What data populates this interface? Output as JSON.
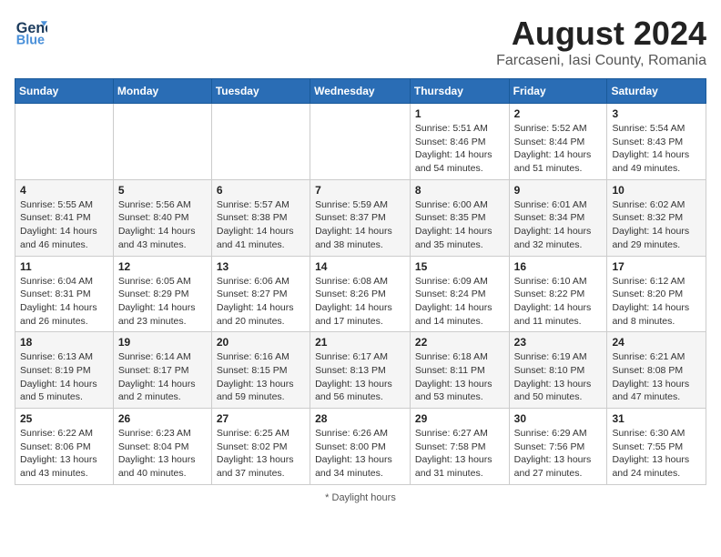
{
  "header": {
    "logo_line1": "General",
    "logo_line2": "Blue",
    "main_title": "August 2024",
    "subtitle": "Farcaseni, Iasi County, Romania"
  },
  "weekdays": [
    "Sunday",
    "Monday",
    "Tuesday",
    "Wednesday",
    "Thursday",
    "Friday",
    "Saturday"
  ],
  "weeks": [
    [
      {
        "day": "",
        "sunrise": "",
        "sunset": "",
        "daylight": ""
      },
      {
        "day": "",
        "sunrise": "",
        "sunset": "",
        "daylight": ""
      },
      {
        "day": "",
        "sunrise": "",
        "sunset": "",
        "daylight": ""
      },
      {
        "day": "",
        "sunrise": "",
        "sunset": "",
        "daylight": ""
      },
      {
        "day": "1",
        "sunrise": "Sunrise: 5:51 AM",
        "sunset": "Sunset: 8:46 PM",
        "daylight": "Daylight: 14 hours and 54 minutes."
      },
      {
        "day": "2",
        "sunrise": "Sunrise: 5:52 AM",
        "sunset": "Sunset: 8:44 PM",
        "daylight": "Daylight: 14 hours and 51 minutes."
      },
      {
        "day": "3",
        "sunrise": "Sunrise: 5:54 AM",
        "sunset": "Sunset: 8:43 PM",
        "daylight": "Daylight: 14 hours and 49 minutes."
      }
    ],
    [
      {
        "day": "4",
        "sunrise": "Sunrise: 5:55 AM",
        "sunset": "Sunset: 8:41 PM",
        "daylight": "Daylight: 14 hours and 46 minutes."
      },
      {
        "day": "5",
        "sunrise": "Sunrise: 5:56 AM",
        "sunset": "Sunset: 8:40 PM",
        "daylight": "Daylight: 14 hours and 43 minutes."
      },
      {
        "day": "6",
        "sunrise": "Sunrise: 5:57 AM",
        "sunset": "Sunset: 8:38 PM",
        "daylight": "Daylight: 14 hours and 41 minutes."
      },
      {
        "day": "7",
        "sunrise": "Sunrise: 5:59 AM",
        "sunset": "Sunset: 8:37 PM",
        "daylight": "Daylight: 14 hours and 38 minutes."
      },
      {
        "day": "8",
        "sunrise": "Sunrise: 6:00 AM",
        "sunset": "Sunset: 8:35 PM",
        "daylight": "Daylight: 14 hours and 35 minutes."
      },
      {
        "day": "9",
        "sunrise": "Sunrise: 6:01 AM",
        "sunset": "Sunset: 8:34 PM",
        "daylight": "Daylight: 14 hours and 32 minutes."
      },
      {
        "day": "10",
        "sunrise": "Sunrise: 6:02 AM",
        "sunset": "Sunset: 8:32 PM",
        "daylight": "Daylight: 14 hours and 29 minutes."
      }
    ],
    [
      {
        "day": "11",
        "sunrise": "Sunrise: 6:04 AM",
        "sunset": "Sunset: 8:31 PM",
        "daylight": "Daylight: 14 hours and 26 minutes."
      },
      {
        "day": "12",
        "sunrise": "Sunrise: 6:05 AM",
        "sunset": "Sunset: 8:29 PM",
        "daylight": "Daylight: 14 hours and 23 minutes."
      },
      {
        "day": "13",
        "sunrise": "Sunrise: 6:06 AM",
        "sunset": "Sunset: 8:27 PM",
        "daylight": "Daylight: 14 hours and 20 minutes."
      },
      {
        "day": "14",
        "sunrise": "Sunrise: 6:08 AM",
        "sunset": "Sunset: 8:26 PM",
        "daylight": "Daylight: 14 hours and 17 minutes."
      },
      {
        "day": "15",
        "sunrise": "Sunrise: 6:09 AM",
        "sunset": "Sunset: 8:24 PM",
        "daylight": "Daylight: 14 hours and 14 minutes."
      },
      {
        "day": "16",
        "sunrise": "Sunrise: 6:10 AM",
        "sunset": "Sunset: 8:22 PM",
        "daylight": "Daylight: 14 hours and 11 minutes."
      },
      {
        "day": "17",
        "sunrise": "Sunrise: 6:12 AM",
        "sunset": "Sunset: 8:20 PM",
        "daylight": "Daylight: 14 hours and 8 minutes."
      }
    ],
    [
      {
        "day": "18",
        "sunrise": "Sunrise: 6:13 AM",
        "sunset": "Sunset: 8:19 PM",
        "daylight": "Daylight: 14 hours and 5 minutes."
      },
      {
        "day": "19",
        "sunrise": "Sunrise: 6:14 AM",
        "sunset": "Sunset: 8:17 PM",
        "daylight": "Daylight: 14 hours and 2 minutes."
      },
      {
        "day": "20",
        "sunrise": "Sunrise: 6:16 AM",
        "sunset": "Sunset: 8:15 PM",
        "daylight": "Daylight: 13 hours and 59 minutes."
      },
      {
        "day": "21",
        "sunrise": "Sunrise: 6:17 AM",
        "sunset": "Sunset: 8:13 PM",
        "daylight": "Daylight: 13 hours and 56 minutes."
      },
      {
        "day": "22",
        "sunrise": "Sunrise: 6:18 AM",
        "sunset": "Sunset: 8:11 PM",
        "daylight": "Daylight: 13 hours and 53 minutes."
      },
      {
        "day": "23",
        "sunrise": "Sunrise: 6:19 AM",
        "sunset": "Sunset: 8:10 PM",
        "daylight": "Daylight: 13 hours and 50 minutes."
      },
      {
        "day": "24",
        "sunrise": "Sunrise: 6:21 AM",
        "sunset": "Sunset: 8:08 PM",
        "daylight": "Daylight: 13 hours and 47 minutes."
      }
    ],
    [
      {
        "day": "25",
        "sunrise": "Sunrise: 6:22 AM",
        "sunset": "Sunset: 8:06 PM",
        "daylight": "Daylight: 13 hours and 43 minutes."
      },
      {
        "day": "26",
        "sunrise": "Sunrise: 6:23 AM",
        "sunset": "Sunset: 8:04 PM",
        "daylight": "Daylight: 13 hours and 40 minutes."
      },
      {
        "day": "27",
        "sunrise": "Sunrise: 6:25 AM",
        "sunset": "Sunset: 8:02 PM",
        "daylight": "Daylight: 13 hours and 37 minutes."
      },
      {
        "day": "28",
        "sunrise": "Sunrise: 6:26 AM",
        "sunset": "Sunset: 8:00 PM",
        "daylight": "Daylight: 13 hours and 34 minutes."
      },
      {
        "day": "29",
        "sunrise": "Sunrise: 6:27 AM",
        "sunset": "Sunset: 7:58 PM",
        "daylight": "Daylight: 13 hours and 31 minutes."
      },
      {
        "day": "30",
        "sunrise": "Sunrise: 6:29 AM",
        "sunset": "Sunset: 7:56 PM",
        "daylight": "Daylight: 13 hours and 27 minutes."
      },
      {
        "day": "31",
        "sunrise": "Sunrise: 6:30 AM",
        "sunset": "Sunset: 7:55 PM",
        "daylight": "Daylight: 13 hours and 24 minutes."
      }
    ]
  ],
  "footer": {
    "note": "Daylight hours"
  }
}
